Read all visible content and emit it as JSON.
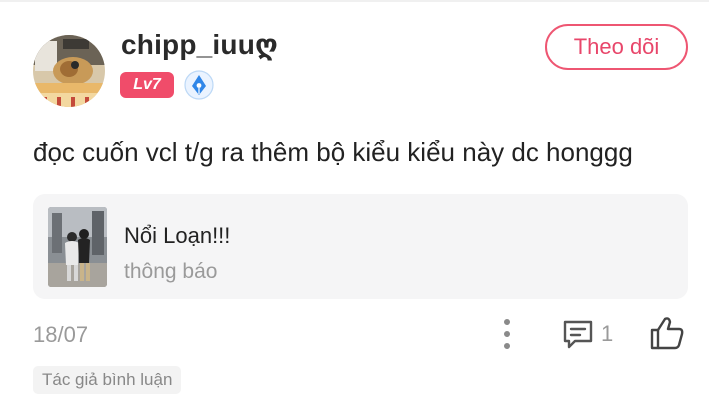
{
  "user": {
    "name": "chipp_iuuღ",
    "level": "Lv7",
    "avatar_icon": "avatar-image",
    "level_color": "#f04c6a",
    "extra_badge_icon": "pen-nib-badge-icon"
  },
  "follow_button": {
    "label": "Theo dõi",
    "color": "#e8466a"
  },
  "comment": {
    "text": "đọc cuốn vcl t/g ra thêm bộ kiểu kiểu này dc honggg"
  },
  "book": {
    "title": "Nổi Loạn!!!",
    "subtitle": "thông báo",
    "cover_icon": "book-cover-image",
    "card_background": "#f5f5f6"
  },
  "footer": {
    "date": "18/07",
    "comment_count": "1",
    "author_tag": "Tác giả bình luận",
    "icons": [
      "more-vertical-icon",
      "comment-icon",
      "thumbs-up-icon"
    ]
  }
}
